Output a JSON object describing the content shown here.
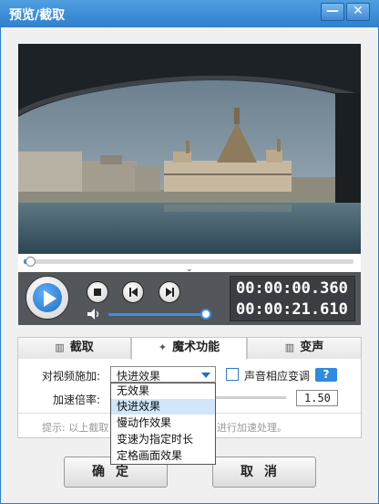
{
  "window": {
    "title": "预览/截取",
    "minimize": "—",
    "close": "✕"
  },
  "player": {
    "current_time": "00:00:00.360",
    "total_time": "00:00:21.610",
    "progress_fraction": 0.01,
    "volume_fraction": 1.0
  },
  "tabs": [
    {
      "label": "截取",
      "icon": "cut-icon",
      "glyph": "▥"
    },
    {
      "label": "魔术功能",
      "icon": "magic-icon",
      "glyph": "✦"
    },
    {
      "label": "变声",
      "icon": "voice-icon",
      "glyph": "▥"
    }
  ],
  "active_tab": 1,
  "magic": {
    "apply_label": "对视频施加:",
    "selected_effect": "快进效果",
    "effect_options": [
      "无效果",
      "快进效果",
      "慢动作效果",
      "变速为指定时长",
      "定格画面效果"
    ],
    "highlighted_option": 1,
    "pitch_label": "声音相应变调",
    "help_label": "?",
    "speed_label": "加速倍率:",
    "speed_value": "1.50",
    "hint_left": "提示: 以上截取",
    "hint_right": "进行加速处理。"
  },
  "buttons": {
    "ok": "确定",
    "cancel": "取消"
  },
  "colors": {
    "titlebar": "#2f7fcc",
    "accent": "#1e6fc7",
    "controls_bg": "#53575c"
  }
}
